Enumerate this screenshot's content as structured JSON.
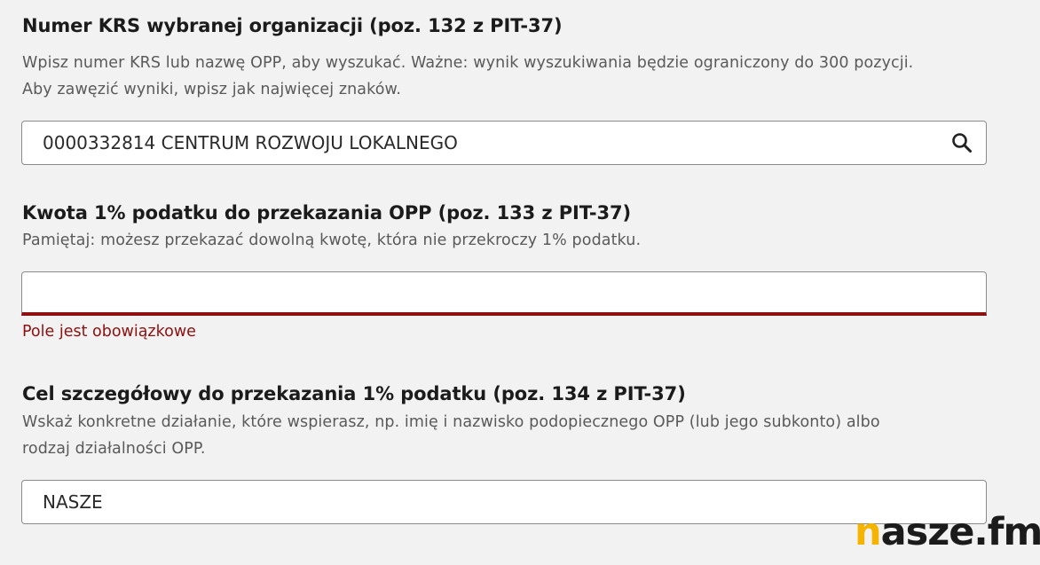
{
  "krs_section": {
    "title": "Numer KRS wybranej organizacji (poz. 132 z PIT-37)",
    "hint_line1": "Wpisz numer KRS lub nazwę OPP, aby wyszukać. Ważne: wynik wyszukiwania będzie ograniczony do 300 pozycji.",
    "hint_line2": "Aby zawęzić wyniki, wpisz jak najwięcej znaków.",
    "input_value": "0000332814 CENTRUM ROZWOJU LOKALNEGO",
    "search_icon": "search-icon"
  },
  "amount_section": {
    "title": "Kwota 1% podatku do przekazania OPP (poz. 133 z PIT-37)",
    "hint": "Pamiętaj: możesz przekazać dowolną kwotę, która nie przekroczy 1% podatku.",
    "input_value": "",
    "error": "Pole jest obowiązkowe",
    "error_color": "#8f1010"
  },
  "goal_section": {
    "title": "Cel szczegółowy do przekazania 1% podatku (poz. 134 z PIT-37)",
    "hint_line1": "Wskaż konkretne działanie, które wspierasz, np. imię i nazwisko podopiecznego OPP (lub jego subkonto) albo",
    "hint_line2": "rodzaj działalności OPP.",
    "input_value": "NASZE"
  },
  "watermark": {
    "first_letter": "n",
    "rest": "asze.fm",
    "accent_color": "#f4b400"
  }
}
